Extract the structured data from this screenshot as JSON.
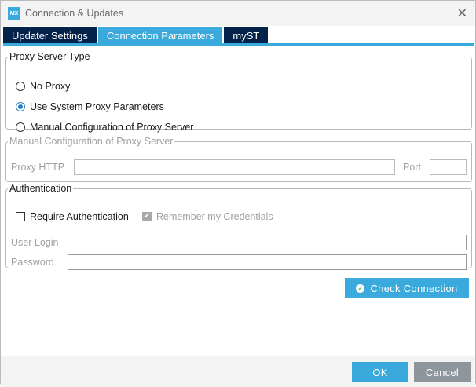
{
  "window": {
    "title": "Connection & Updates",
    "logo": "MX"
  },
  "tabs": [
    {
      "label": "Updater Settings"
    },
    {
      "label": "Connection Parameters"
    },
    {
      "label": "myST"
    }
  ],
  "proxy_type": {
    "legend": "Proxy Server Type",
    "options": [
      {
        "label": "No Proxy",
        "selected": false
      },
      {
        "label": "Use System Proxy Parameters",
        "selected": true
      },
      {
        "label": "Manual Configuration of Proxy Server",
        "selected": false
      }
    ]
  },
  "manual": {
    "legend": "Manual Configuration of Proxy Server",
    "proxy_http_label": "Proxy HTTP",
    "proxy_http_value": "",
    "port_label": "Port",
    "port_value": ""
  },
  "auth": {
    "legend": "Authentication",
    "require_label": "Require Authentication",
    "require_checked": false,
    "remember_label": "Remember my Credentials",
    "remember_checked": true,
    "user_login_label": "User Login",
    "user_login_value": "",
    "password_label": "Password",
    "password_value": ""
  },
  "buttons": {
    "check": "Check Connection",
    "ok": "OK",
    "cancel": "Cancel"
  },
  "colors": {
    "accent": "#3aa9dc",
    "tab_dark": "#03234b",
    "cancel": "#8e969d"
  }
}
